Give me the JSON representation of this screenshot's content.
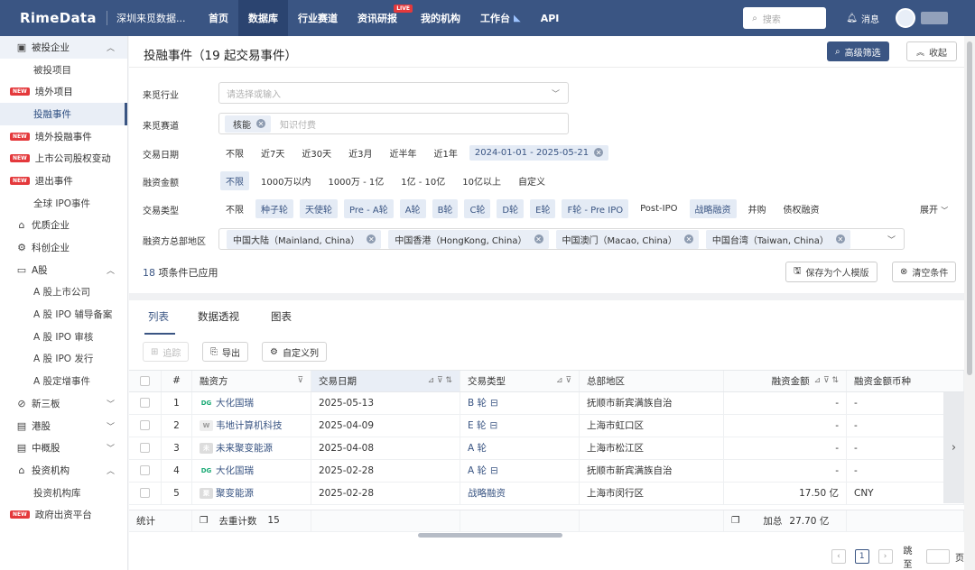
{
  "topnav": {
    "logo": "RimeData",
    "org": "深圳来觅数据...",
    "items": [
      {
        "label": "首页"
      },
      {
        "label": "数据库"
      },
      {
        "label": "行业赛道"
      },
      {
        "label": "资讯研报"
      },
      {
        "label": "我的机构"
      },
      {
        "label": "工作台"
      },
      {
        "label": "API"
      }
    ],
    "live_badge": "LIVE",
    "search_placeholder": "搜索",
    "message": "消息"
  },
  "sidebar": {
    "items": [
      {
        "label": "被投企业",
        "icon": "building-icon"
      },
      {
        "label": "被投项目"
      },
      {
        "label": "境外项目",
        "badge": "NEW"
      },
      {
        "label": "投融事件"
      },
      {
        "label": "境外投融事件",
        "badge": "NEW"
      },
      {
        "label": "上市公司股权变动",
        "badge": "NEW"
      },
      {
        "label": "退出事件",
        "badge": "NEW"
      },
      {
        "label": "全球 IPO事件"
      },
      {
        "label": "优质企业",
        "icon": "star-building-icon"
      },
      {
        "label": "科创企业",
        "icon": "tech-icon"
      },
      {
        "label": "A股",
        "icon": "monitor-icon"
      },
      {
        "label": "A 股上市公司"
      },
      {
        "label": "A 股 IPO 辅导备案"
      },
      {
        "label": "A 股 IPO 审核"
      },
      {
        "label": "A 股 IPO 发行"
      },
      {
        "label": "A 股定增事件"
      },
      {
        "label": "新三板",
        "icon": "circle-icon"
      },
      {
        "label": "港股",
        "icon": "chart-icon"
      },
      {
        "label": "中概股",
        "icon": "chart-icon"
      },
      {
        "label": "投资机构",
        "icon": "bank-icon"
      },
      {
        "label": "投资机构库"
      },
      {
        "label": "政府出资平台",
        "badge": "NEW"
      }
    ]
  },
  "page": {
    "title": "投融事件（19 起交易事件）",
    "advanced_filter": "高级筛选",
    "collapse": "收起"
  },
  "filters": {
    "industry_label": "来觅行业",
    "industry_placeholder": "请选择或输入",
    "track_label": "来觅赛道",
    "track_tag": "核能",
    "track_placeholder": "知识付费",
    "date_label": "交易日期",
    "date_options": [
      "不限",
      "近7天",
      "近30天",
      "近3月",
      "近半年",
      "近1年"
    ],
    "date_range": "2024-01-01 - 2025-05-21",
    "amount_label": "融资金额",
    "amount_options": [
      "不限",
      "1000万以内",
      "1000万 - 1亿",
      "1亿 - 10亿",
      "10亿以上",
      "自定义"
    ],
    "type_label": "交易类型",
    "type_options": [
      "不限",
      "种子轮",
      "天使轮",
      "Pre - A轮",
      "A轮",
      "B轮",
      "C轮",
      "D轮",
      "E轮",
      "F轮 - Pre IPO",
      "Post-IPO",
      "战略融资",
      "并购",
      "债权融资"
    ],
    "expand": "展开",
    "region_label": "融资方总部地区",
    "regions": [
      "中国大陆（Mainland, China）",
      "中国香港（HongKong, China）",
      "中国澳门（Macao, China）",
      "中国台湾（Taiwan, China）"
    ],
    "applied_count": "18",
    "applied_text": " 项条件已应用",
    "save_template": "保存为个人模版",
    "clear": "清空条件"
  },
  "tabs": [
    "列表",
    "数据透视",
    "图表"
  ],
  "toolbar": {
    "track": "追踪",
    "export": "导出",
    "custom_columns": "自定义列"
  },
  "table": {
    "headers": [
      "#",
      "融资方",
      "交易日期",
      "交易类型",
      "总部地区",
      "融资金额",
      "融资金额币种"
    ],
    "rows": [
      {
        "n": "1",
        "logo": "DG",
        "company": "大化国瑞",
        "date": "2025-05-13",
        "type": "B 轮",
        "region": "抚顺市新宾满族自治",
        "amount": "-",
        "currency": "-"
      },
      {
        "n": "2",
        "logo": "W",
        "company": "韦地计算机科技",
        "date": "2025-04-09",
        "type": "E 轮",
        "region": "上海市虹口区",
        "amount": "-",
        "currency": "-"
      },
      {
        "n": "3",
        "logo": "未",
        "company": "未来聚变能源",
        "date": "2025-04-08",
        "type": "A 轮",
        "region": "上海市松江区",
        "amount": "-",
        "currency": "-"
      },
      {
        "n": "4",
        "logo": "DG",
        "company": "大化国瑞",
        "date": "2025-02-28",
        "type": "A 轮",
        "region": "抚顺市新宾满族自治",
        "amount": "-",
        "currency": "-"
      },
      {
        "n": "5",
        "logo": "聚",
        "company": "聚变能源",
        "date": "2025-02-28",
        "type": "战略融资",
        "region": "上海市闵行区",
        "amount": "17.50 亿",
        "currency": "CNY"
      }
    ],
    "footer": {
      "label": "统计",
      "dedup_label": "去重计数",
      "dedup_value": "15",
      "sum_label": "加总",
      "sum_value": "27.70 亿"
    }
  },
  "pager": {
    "page": "1",
    "jump_label": "跳至",
    "page_suffix": "页"
  }
}
